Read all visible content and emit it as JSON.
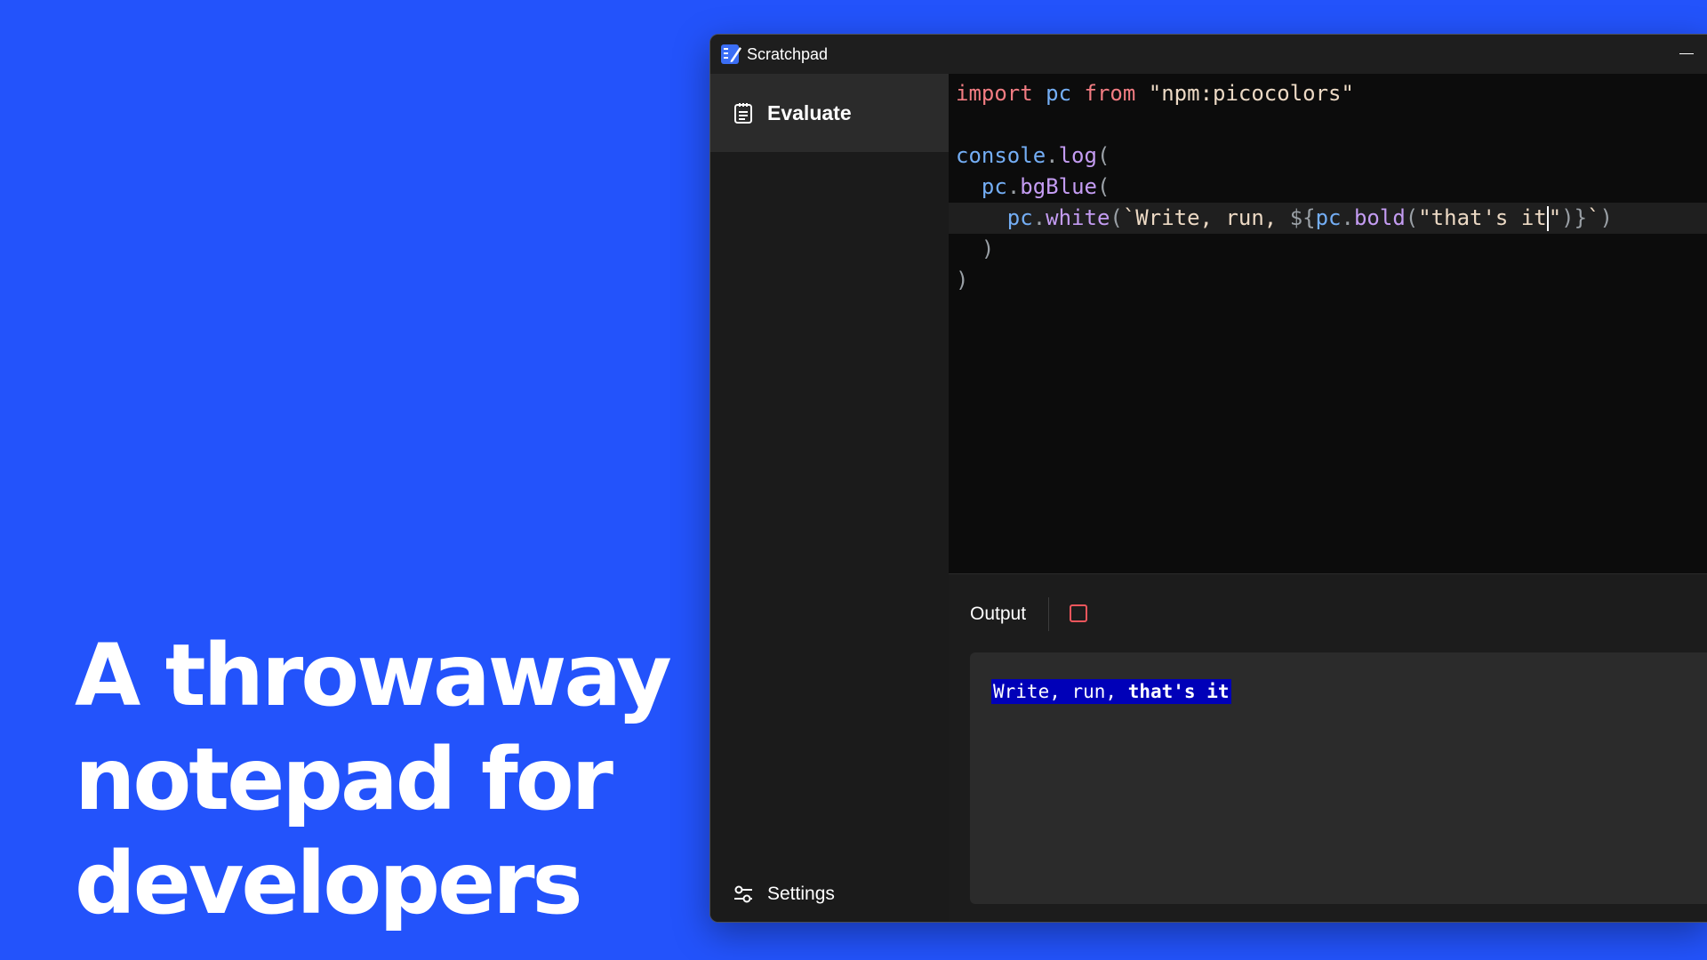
{
  "hero": {
    "line1": "A throwaway",
    "line2": "notepad for",
    "line3": "developers"
  },
  "window": {
    "title": "Scratchpad"
  },
  "sidebar": {
    "items": [
      {
        "label": "Evaluate",
        "icon": "clipboard-icon",
        "selected": true
      }
    ],
    "settings_label": "Settings",
    "settings_icon": "sliders-icon"
  },
  "editor": {
    "lines": [
      "import pc from \"npm:picocolors\"",
      "",
      "console.log(",
      "  pc.bgBlue(",
      "    pc.white(`Write, run, ${pc.bold(\"that's it\")}`)",
      "  )",
      ")"
    ],
    "tokens": {
      "l1_import": "import",
      "l1_pc": "pc",
      "l1_from": "from",
      "l1_module": "\"npm:picocolors\"",
      "l3_console": "console",
      "l3_dot": ".",
      "l3_log": "log",
      "l3_paren": "(",
      "l4_pc": "pc",
      "l4_dot": ".",
      "l4_bgBlue": "bgBlue",
      "l4_paren": "(",
      "l5_pc": "pc",
      "l5_dot": ".",
      "l5_white": "white",
      "l5_paren": "(",
      "l5_tpl": "`Write, run, ",
      "l5_interp_open": "${",
      "l5_pc2": "pc",
      "l5_dot2": ".",
      "l5_bold": "bold",
      "l5_paren2": "(",
      "l5_str": "\"that's it",
      "l5_str_end": "\"",
      "l5_close": ")}",
      "l5_tick": "`",
      "l5_paren_close": ")",
      "l6_paren": ")",
      "l7_paren": ")"
    },
    "active_line": 5
  },
  "output": {
    "label": "Output",
    "stop_icon": "stop-icon",
    "text_plain": "Write, run, ",
    "text_bold": "that's it",
    "background_color": "#0000b8"
  },
  "colors": {
    "background": "#2353fb",
    "keyword": "#f27c82",
    "identifier": "#74aef5",
    "function": "#c49cf2",
    "string": "#ecd9c4",
    "stop": "#f0565c"
  }
}
